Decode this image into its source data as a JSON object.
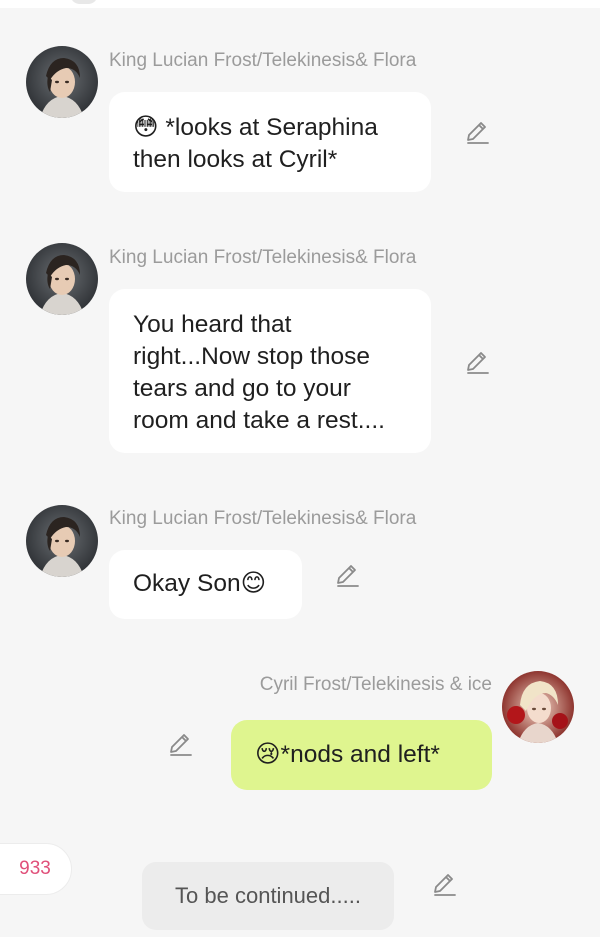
{
  "messages": [
    {
      "sender": "King Lucian Frost/Telekinesis& Flora",
      "text": "😳 *looks at Seraphina then looks at Cyril*",
      "side": "left"
    },
    {
      "sender": "King Lucian Frost/Telekinesis& Flora",
      "text": "You heard that right...Now stop those tears and go to your room and take a rest....",
      "side": "left"
    },
    {
      "sender": "King Lucian Frost/Telekinesis& Flora",
      "text": "Okay Son😊",
      "side": "left"
    },
    {
      "sender": "Cyril Frost/Telekinesis & ice",
      "text": "😢*nods and left*",
      "side": "right"
    }
  ],
  "footer": {
    "counter": "933",
    "continuation": "To be continued....."
  },
  "icons": {
    "edit": "pencil-edit-icon",
    "avatar_left": "king-lucian-avatar",
    "avatar_right": "cyril-avatar"
  },
  "colors": {
    "background": "#f6f6f6",
    "bot_bubble": "#ffffff",
    "user_bubble": "#dff58f",
    "sender_text": "#9b9b9b",
    "counter_text": "#e0507a"
  }
}
